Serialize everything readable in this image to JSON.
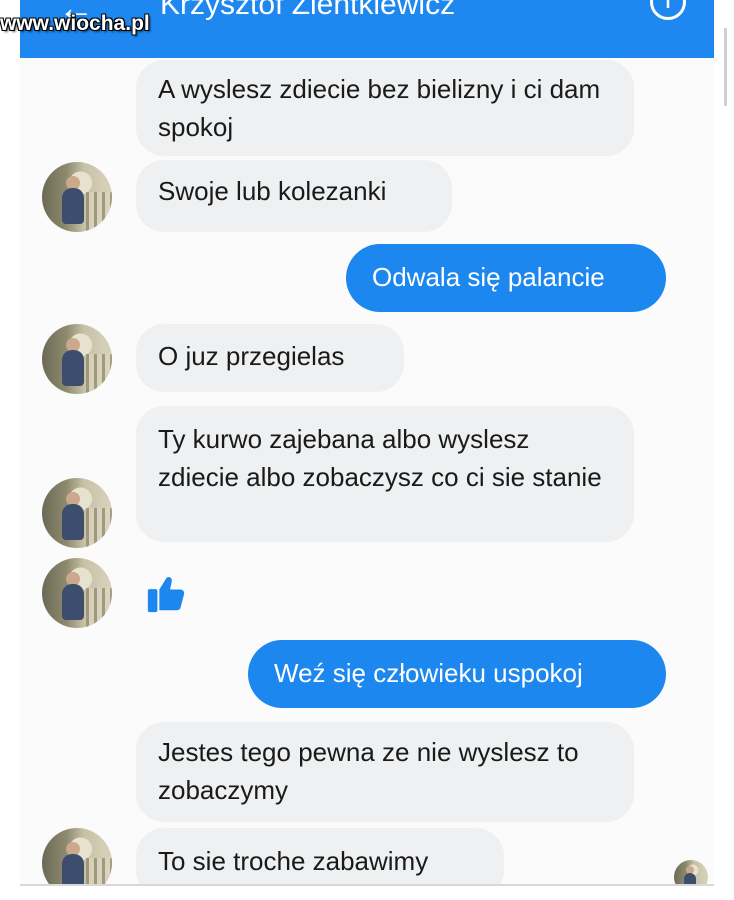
{
  "header": {
    "back_icon": "arrow-left-icon",
    "title": "Krzysztof Zientkiewicz",
    "info_icon": "info-icon",
    "info_glyph": "i",
    "color": "#1e88f0"
  },
  "watermark": {
    "text": "www.wiocha.pl"
  },
  "messages": [
    {
      "side": "received",
      "text": "A wyslesz zdiecie bez bielizny i ci dam spokoj"
    },
    {
      "side": "received",
      "text": "Swoje lub kolezanki"
    },
    {
      "side": "sent",
      "text": "Odwala się palancie"
    },
    {
      "side": "received",
      "text": "O juz przegielas"
    },
    {
      "side": "received",
      "text": "Ty kurwo zajebana albo wyslesz zdiecie albo zobaczysz co ci sie stanie"
    },
    {
      "side": "received",
      "type": "like",
      "icon": "thumbs-up-icon"
    },
    {
      "side": "sent",
      "text": "Weź się człowieku uspokoj"
    },
    {
      "side": "received",
      "text": "Jestes tego pewna ze nie wyslesz to zobaczymy"
    },
    {
      "side": "received",
      "text": "To sie troche zabawimy"
    }
  ],
  "colors": {
    "sent_bubble": "#1d87f0",
    "received_bubble": "#eef0f1"
  }
}
